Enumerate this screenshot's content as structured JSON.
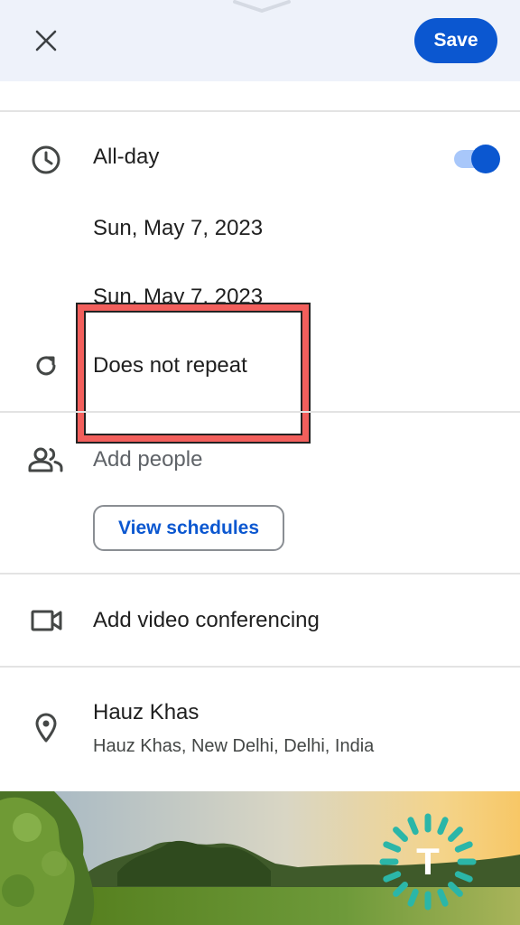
{
  "header": {
    "close_icon": "close-icon",
    "save_label": "Save"
  },
  "event": {
    "all_day_label": "All-day",
    "all_day_enabled": true,
    "start_date": "Sun, May 7, 2023",
    "end_date": "Sun, May 7, 2023",
    "repeat_label": "Does not repeat",
    "add_people_placeholder": "Add people",
    "view_schedules_label": "View schedules",
    "video_conferencing_label": "Add video conferencing",
    "location_name": "Hauz Khas",
    "location_address": "Hauz Khas, New Delhi, Delhi, India"
  },
  "watermark": {
    "letter": "T"
  },
  "colors": {
    "accent": "#0b57d0",
    "highlight": "#f25f5c",
    "toolbar_bg": "#eef2fa"
  }
}
